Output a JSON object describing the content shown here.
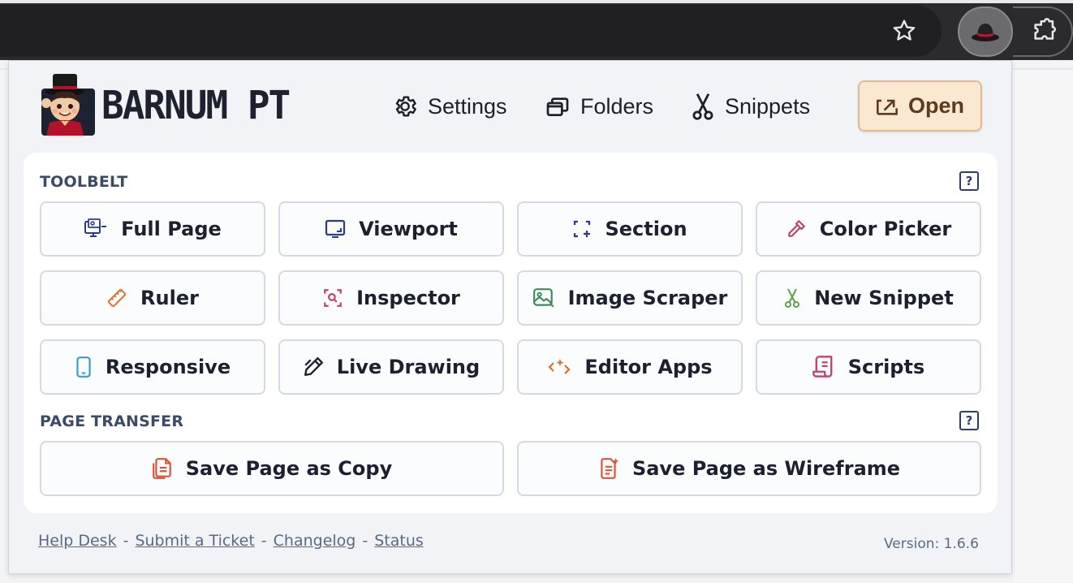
{
  "browser": {
    "bookmark_icon": "star-icon",
    "active_extension_icon": "hat-icon",
    "extensions_icon": "puzzle-icon"
  },
  "header": {
    "logo_text": "BARNUM PT",
    "nav": [
      {
        "label": "Settings",
        "icon": "gear-icon"
      },
      {
        "label": "Folders",
        "icon": "folders-icon"
      },
      {
        "label": "Snippets",
        "icon": "scissors-icon"
      }
    ],
    "open_label": "Open"
  },
  "toolbelt": {
    "label": "TOOLBELT",
    "help": "?",
    "tools": [
      {
        "label": "Full Page",
        "icon": "full-page-icon",
        "color": "#2b3a8c"
      },
      {
        "label": "Viewport",
        "icon": "viewport-icon",
        "color": "#2b3a8c"
      },
      {
        "label": "Section",
        "icon": "section-icon",
        "color": "#2b3a8c"
      },
      {
        "label": "Color Picker",
        "icon": "eyedropper-icon",
        "color": "#c2406b"
      },
      {
        "label": "Ruler",
        "icon": "ruler-icon",
        "color": "#e07a3a"
      },
      {
        "label": "Inspector",
        "icon": "inspector-icon",
        "color": "#c2406b"
      },
      {
        "label": "Image Scraper",
        "icon": "image-icon",
        "color": "#3f8a5a"
      },
      {
        "label": "New Snippet",
        "icon": "scissors-icon",
        "color": "#5fa14a"
      },
      {
        "label": "Responsive",
        "icon": "phone-icon",
        "color": "#3a9ac9"
      },
      {
        "label": "Live Drawing",
        "icon": "pen-icon",
        "color": "#1c2130"
      },
      {
        "label": "Editor Apps",
        "icon": "code-icon",
        "color": "#d9712e"
      },
      {
        "label": "Scripts",
        "icon": "scroll-icon",
        "color": "#c2406b"
      }
    ]
  },
  "transfer": {
    "label": "PAGE TRANSFER",
    "help": "?",
    "buttons": [
      {
        "label": "Save Page as Copy",
        "icon": "copy-doc-icon",
        "color": "#d9533a"
      },
      {
        "label": "Save Page as Wireframe",
        "icon": "wireframe-doc-icon",
        "color": "#d9533a"
      }
    ]
  },
  "footer": {
    "links": [
      "Help Desk",
      "Submit a Ticket",
      "Changelog",
      "Status"
    ],
    "separator": "-",
    "version": "Version: 1.6.6"
  }
}
